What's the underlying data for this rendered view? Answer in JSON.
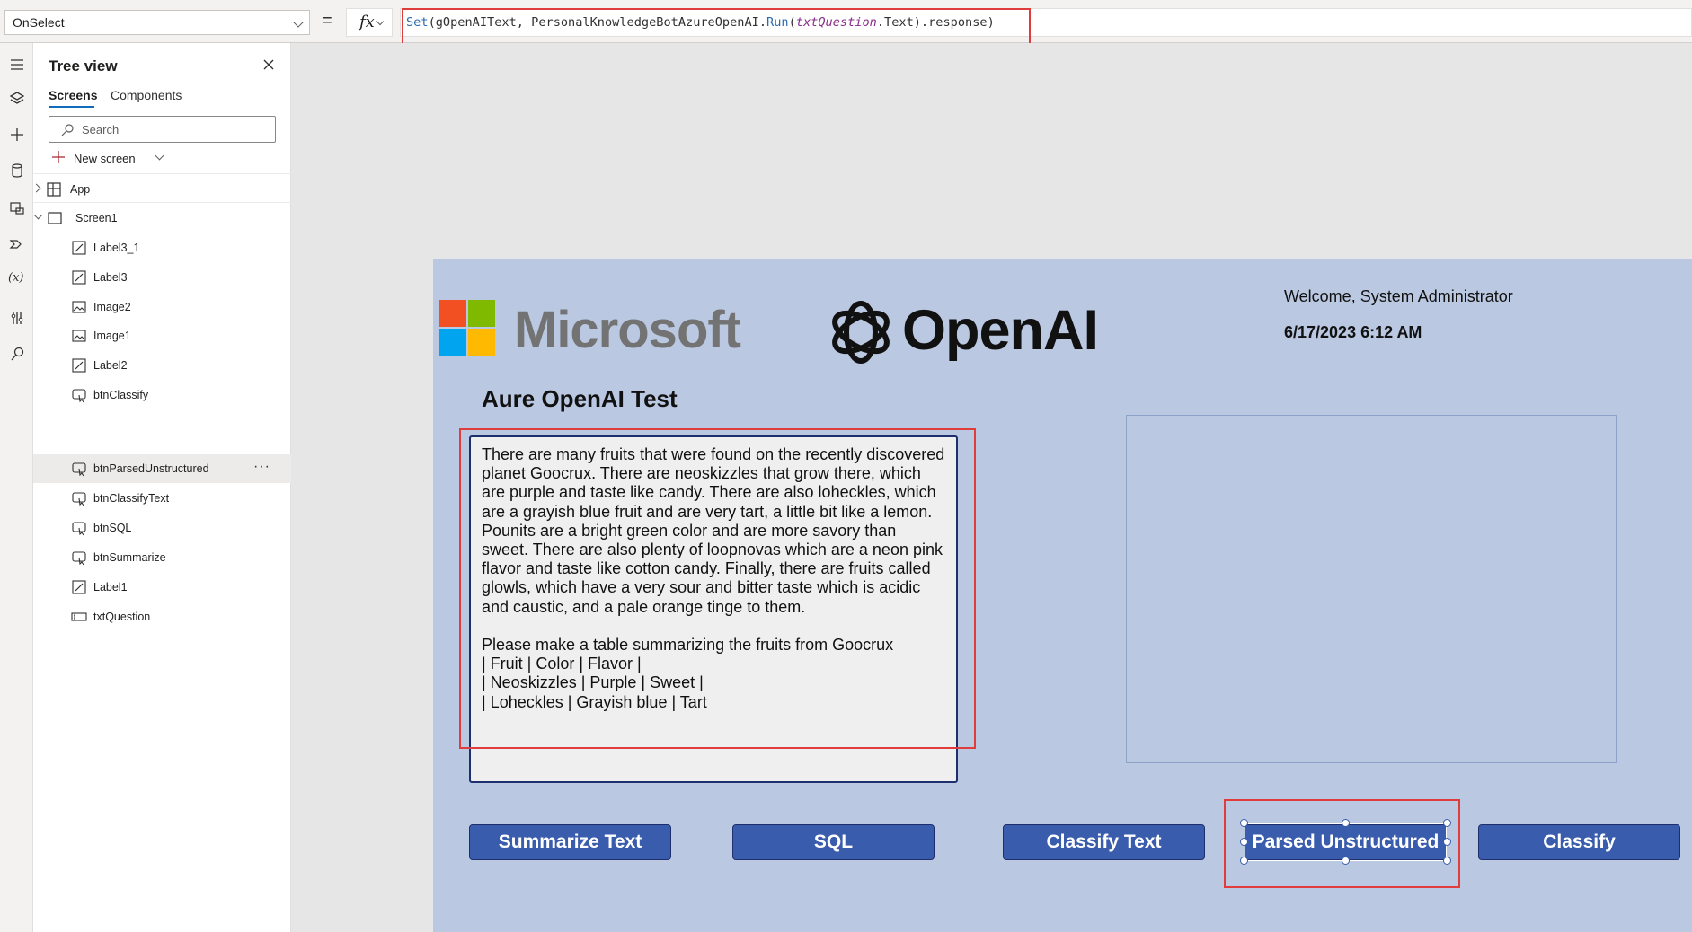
{
  "formula_bar": {
    "property": "OnSelect",
    "equals": "=",
    "fx_label": "fx",
    "formula": {
      "part1": "Set",
      "part2": "(gOpenAIText, PersonalKnowledgeBotAzureOpenAI.",
      "part3": "Run",
      "part4": "(",
      "part5": "txtQuestion",
      "part6": ".Text).response)"
    }
  },
  "tree_view": {
    "title": "Tree view",
    "tabs": {
      "screens": "Screens",
      "components": "Components"
    },
    "search_placeholder": "Search",
    "new_screen": "New screen",
    "items": [
      {
        "label": "App",
        "icon": "app-icon"
      },
      {
        "label": "Screen1",
        "icon": "screen-icon"
      },
      {
        "label": "Label3_1",
        "icon": "label-icon"
      },
      {
        "label": "Label3",
        "icon": "label-icon"
      },
      {
        "label": "Image2",
        "icon": "image-icon"
      },
      {
        "label": "Image1",
        "icon": "image-icon"
      },
      {
        "label": "Label2",
        "icon": "label-icon"
      },
      {
        "label": "btnClassify",
        "icon": "button-icon"
      },
      {
        "label": "btnParsedUnstructured",
        "icon": "button-icon"
      },
      {
        "label": "btnClassifyText",
        "icon": "button-icon"
      },
      {
        "label": "btnSQL",
        "icon": "button-icon"
      },
      {
        "label": "btnSummarize",
        "icon": "button-icon"
      },
      {
        "label": "Label1",
        "icon": "label-icon"
      },
      {
        "label": "txtQuestion",
        "icon": "textinput-icon"
      }
    ],
    "more_label": "···"
  },
  "app_screen": {
    "microsoft_logo_text": "Microsoft",
    "openai_logo_text": "OpenAI",
    "welcome": "Welcome, System Administrator",
    "datetime": "6/17/2023 6:12 AM",
    "title": "Aure OpenAI Test",
    "question_text": "There are many fruits that were found on the recently discovered planet Goocrux. There are neoskizzles that grow there, which are purple and taste like candy. There are also loheckles, which are a grayish blue fruit and are very tart, a little bit like a lemon. Pounits are a bright green color and are more savory than sweet. There are also plenty of loopnovas which are a neon pink flavor and taste like cotton candy. Finally, there are fruits called glowls, which have a very sour and bitter taste which is acidic and caustic, and a pale orange tinge to them.\n\nPlease make a table summarizing the fruits from Goocrux\n| Fruit | Color | Flavor |\n| Neoskizzles | Purple | Sweet |\n| Loheckles | Grayish blue | Tart",
    "buttons": {
      "summarize": "Summarize Text",
      "sql": "SQL",
      "classify_text": "Classify Text",
      "parsed_unstructured": "Parsed Unstructured",
      "classify": "Classify"
    },
    "colors": {
      "screen_bg": "#bac8e1",
      "button_bg": "#3a5cad",
      "highlight": "#e03c3c"
    }
  }
}
